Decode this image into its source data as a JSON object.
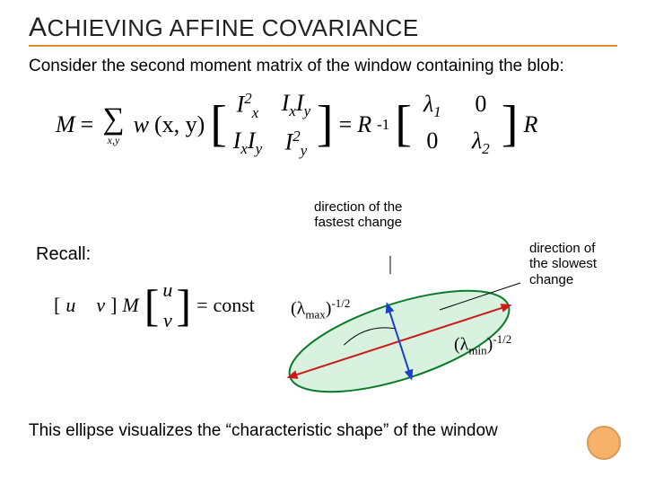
{
  "title": {
    "word1_cap": "A",
    "word1_rest": "CHIEVING",
    "word2": "AFFINE",
    "word3": "COVARIANCE"
  },
  "intro": "Consider the second moment matrix of the window containing the blob:",
  "eq_main": {
    "M": "M",
    "eq": "=",
    "w": "w",
    "args": "(x, y)",
    "Rinv_R": "R",
    "Rinv_exp": "-1",
    "R2": "R",
    "m11": "I",
    "m11s": "x",
    "m11sup": "2",
    "m12a": "I",
    "m12as": "x",
    "m12b": "I",
    "m12bs": "y",
    "m21a": "I",
    "m21as": "x",
    "m21b": "I",
    "m21bs": "y",
    "m22": "I",
    "m22s": "y",
    "m22sup": "2",
    "d11": "λ",
    "d11s": "1",
    "d12": "0",
    "d21": "0",
    "d22": "λ",
    "d22s": "2",
    "sumlim": "x,y"
  },
  "labels": {
    "fastest": "direction of the\nfastest change",
    "slowest": "direction of\nthe slowest\nchange",
    "recall": "Recall:"
  },
  "eq_recall": {
    "uv_open": "[",
    "u": "u",
    "v": "v",
    "uv_close": "]",
    "M": "M",
    "col_u": "u",
    "col_v": "v",
    "eq": "=",
    "rhs": "const"
  },
  "lambda": {
    "lmax_open": "(",
    "lmax_sym": "λ",
    "lmax_sub": "max",
    "lmax_close": ")",
    "lmax_exp": "-1/2",
    "lmin_open": "(",
    "lmin_sym": "λ",
    "lmin_sub": "min",
    "lmin_close": ")",
    "lmin_exp": "-1/2"
  },
  "caption": "This ellipse visualizes the “characteristic shape” of the window",
  "colors": {
    "accent": "#e68a2e",
    "ellipse_stroke": "#0a7a2a",
    "ellipse_fill": "#d9f2e0",
    "axis_red": "#cc1a1a",
    "axis_blue": "#1a3fcc"
  }
}
